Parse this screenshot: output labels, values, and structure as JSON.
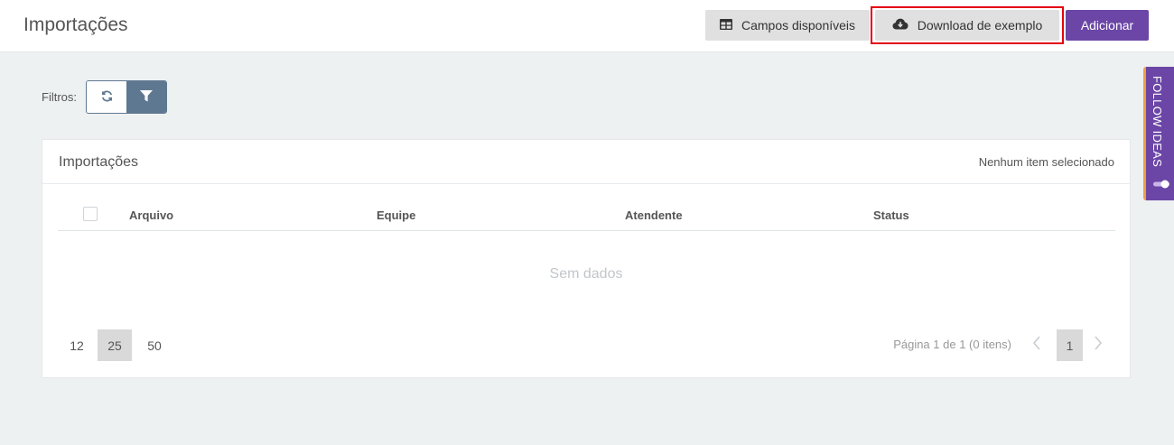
{
  "header": {
    "title": "Importações",
    "buttons": {
      "campos": "Campos disponíveis",
      "download": "Download de exemplo",
      "adicionar": "Adicionar"
    }
  },
  "filters": {
    "label": "Filtros:"
  },
  "card": {
    "title": "Importações",
    "selection_status": "Nenhum item selecionado",
    "columns": [
      "Arquivo",
      "Equipe",
      "Atendente",
      "Status"
    ],
    "empty_text": "Sem dados",
    "page_sizes": [
      "12",
      "25",
      "50"
    ],
    "selected_page_size": "25",
    "page_info": "Página 1 de 1 (0 itens)",
    "current_page": "1"
  },
  "follow_tab": {
    "label": "FOLLOW IDEAS"
  },
  "colors": {
    "primary": "#6b46a6",
    "filter": "#5f7891",
    "highlight": "#e3000f",
    "accent_stripe": "#f0a03c"
  },
  "icons": {
    "campos": "table-icon",
    "download": "cloud-download-icon",
    "refresh": "refresh-icon",
    "filter": "funnel-icon",
    "prev": "chevron-left-icon",
    "next": "chevron-right-icon"
  }
}
